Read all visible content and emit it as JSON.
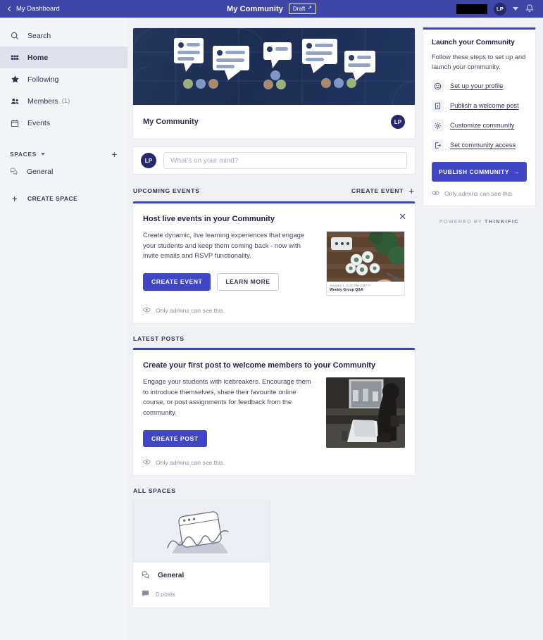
{
  "topbar": {
    "back_label": "My Dashboard",
    "title": "My Community",
    "draft_badge": "Draft",
    "avatar_initials": "LP",
    "accent": "#4046a8"
  },
  "sidebar": {
    "items": [
      {
        "label": "Search",
        "icon": "search-icon",
        "count": ""
      },
      {
        "label": "Home",
        "icon": "grid-icon",
        "count": ""
      },
      {
        "label": "Following",
        "icon": "star-icon",
        "count": ""
      },
      {
        "label": "Members",
        "icon": "people-icon",
        "count": "(1)"
      },
      {
        "label": "Events",
        "icon": "calendar-icon",
        "count": ""
      }
    ],
    "spaces_header": "SPACES",
    "spaces": [
      {
        "label": "General",
        "icon": "chat-bubbles-icon"
      }
    ],
    "create_space_label": "CREATE SPACE"
  },
  "hero": {
    "title": "My Community",
    "avatar_initials": "LP"
  },
  "composer": {
    "avatar_initials": "LP",
    "placeholder": "What's on your mind?"
  },
  "events_section": {
    "title": "UPCOMING EVENTS",
    "action_label": "CREATE EVENT"
  },
  "event_promo": {
    "title": "Host live events in your Community",
    "description": "Create dynamic, live learning experiences that engage your students and keep them coming back - now with invite emails and RSVP functionality.",
    "primary_button": "CREATE EVENT",
    "secondary_button": "LEARN MORE",
    "admins_note": "Only admins can see this",
    "thumb_date": "January 1, 2:30 PM GMT-7",
    "thumb_title": "Weekly Group Q&A"
  },
  "posts_section": {
    "title": "LATEST POSTS"
  },
  "post_promo": {
    "title": "Create your first post to welcome members to your Community",
    "description": "Engage your students with icebreakers. Encourage them to introduce themselves, share their favourite online course, or post assignments for feedback from the community.",
    "primary_button": "CREATE POST",
    "admins_note": "Only admins can see this"
  },
  "all_spaces": {
    "title": "ALL SPACES",
    "cards": [
      {
        "name": "General",
        "posts": "0 posts"
      }
    ]
  },
  "launch_panel": {
    "title": "Launch your Community",
    "subtitle": "Follow these steps to set up and launch your community.",
    "steps": [
      {
        "label": "Set up your profile",
        "icon": "smiley-icon"
      },
      {
        "label": "Publish a welcome post",
        "icon": "document-pin-icon"
      },
      {
        "label": "Customize community",
        "icon": "gear-icon"
      },
      {
        "label": "Set community access",
        "icon": "exit-arrow-icon"
      }
    ],
    "publish_button": "PUBLISH COMMUNITY",
    "admins_note": "Only admins can see this",
    "powered_prefix": "POWERED BY",
    "powered_brand": "THINKIFIC",
    "primary_color": "#4046c5"
  }
}
